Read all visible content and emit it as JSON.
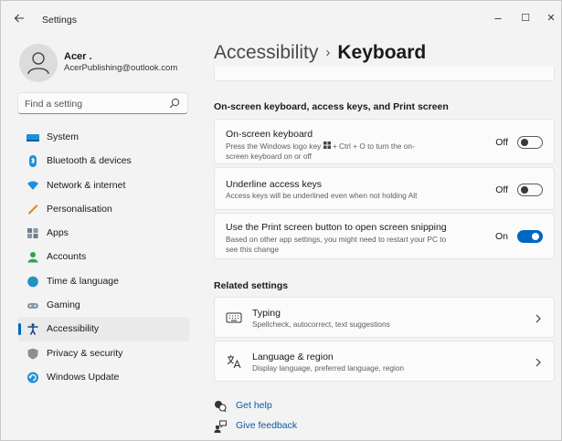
{
  "window": {
    "title": "Settings",
    "back_icon": "back-arrow-icon",
    "controls": {
      "minimize": "–",
      "maximize": "☐",
      "close": "✕"
    }
  },
  "profile": {
    "name": "Acer .",
    "email": "AcerPublishing@outlook.com"
  },
  "search": {
    "placeholder": "Find a setting",
    "value": ""
  },
  "sidebar": {
    "items": [
      {
        "label": "System",
        "icon": "system-icon",
        "active": false
      },
      {
        "label": "Bluetooth & devices",
        "icon": "bluetooth-icon",
        "active": false
      },
      {
        "label": "Network & internet",
        "icon": "network-icon",
        "active": false
      },
      {
        "label": "Personalisation",
        "icon": "personalisation-icon",
        "active": false
      },
      {
        "label": "Apps",
        "icon": "apps-icon",
        "active": false
      },
      {
        "label": "Accounts",
        "icon": "accounts-icon",
        "active": false
      },
      {
        "label": "Time & language",
        "icon": "time-language-icon",
        "active": false
      },
      {
        "label": "Gaming",
        "icon": "gaming-icon",
        "active": false
      },
      {
        "label": "Accessibility",
        "icon": "accessibility-icon",
        "active": true
      },
      {
        "label": "Privacy & security",
        "icon": "privacy-icon",
        "active": false
      },
      {
        "label": "Windows Update",
        "icon": "windows-update-icon",
        "active": false
      }
    ]
  },
  "header": {
    "parent": "Accessibility",
    "separator": "›",
    "current": "Keyboard"
  },
  "section_keyboard": {
    "title": "On-screen keyboard, access keys, and Print screen",
    "settings": [
      {
        "title": "On-screen keyboard",
        "desc_before_icon": "Press the Windows logo key ",
        "desc_after_icon": " + Ctrl + O to turn the on-screen keyboard on or off",
        "state": "Off",
        "on": false
      },
      {
        "title": "Underline access keys",
        "desc": "Access keys will be underlined even when not holding Alt",
        "state": "Off",
        "on": false
      },
      {
        "title": "Use the Print screen button to open screen snipping",
        "desc": "Based on other app settings, you might need to restart your PC to see this change",
        "state": "On",
        "on": true
      }
    ]
  },
  "related": {
    "title": "Related settings",
    "items": [
      {
        "title": "Typing",
        "desc": "Spellcheck, autocorrect, text suggestions",
        "icon": "keyboard-icon"
      },
      {
        "title": "Language & region",
        "desc": "Display language, preferred language, region",
        "icon": "language-icon"
      }
    ]
  },
  "help": {
    "get_help": "Get help",
    "give_feedback": "Give feedback"
  },
  "colors": {
    "accent": "#0067c0",
    "window_bg": "#f3f3f3",
    "card_bg": "#fbfbfb",
    "link": "#0a5aa3"
  }
}
